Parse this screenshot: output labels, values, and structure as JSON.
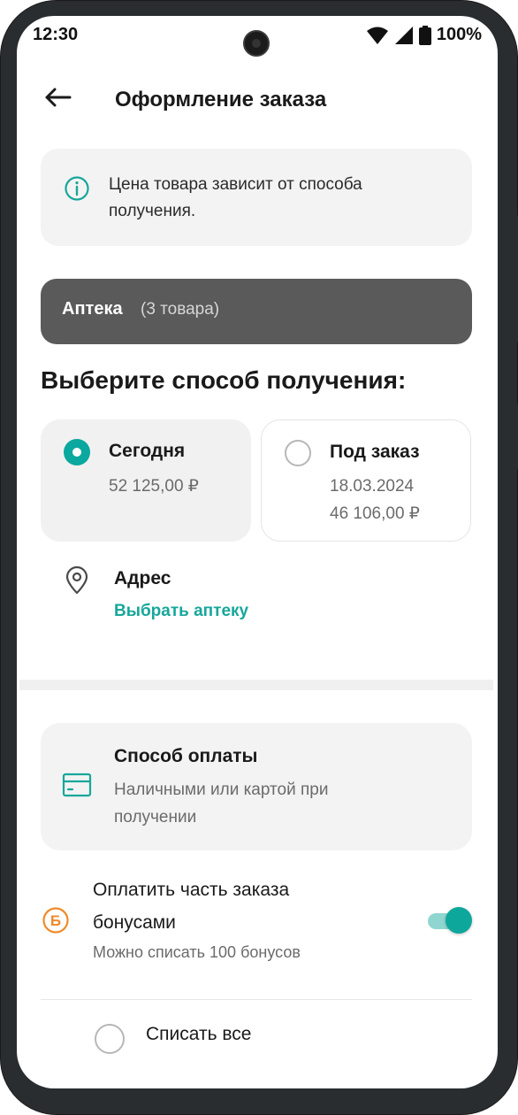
{
  "status": {
    "time": "12:30",
    "battery": "100%"
  },
  "header": {
    "title": "Оформление заказа"
  },
  "info": {
    "text": "Цена товара зависит от способа получения."
  },
  "section": {
    "name": "Аптека",
    "count": "(3 товара)"
  },
  "delivery": {
    "title": "Выберите способ получения:",
    "options": [
      {
        "title": "Сегодня",
        "price": "52 125,00 ₽",
        "selected": true
      },
      {
        "title": "Под заказ",
        "date": "18.03.2024",
        "price": "46 106,00 ₽",
        "selected": false
      }
    ]
  },
  "address": {
    "title": "Адрес",
    "link": "Выбрать аптеку"
  },
  "payment": {
    "title": "Способ оплаты",
    "description": "Наличными или картой при получении"
  },
  "bonus": {
    "title": "Оплатить часть заказа бонусами",
    "subtitle": "Можно списать 100 бонусов",
    "enabled": true,
    "symbol": "Б"
  },
  "writeoff": {
    "label": "Списать все",
    "selected": false
  },
  "colors": {
    "accent": "#0aa89e",
    "bonus": "#f08a2b",
    "section_bg": "#5a5a5a"
  }
}
